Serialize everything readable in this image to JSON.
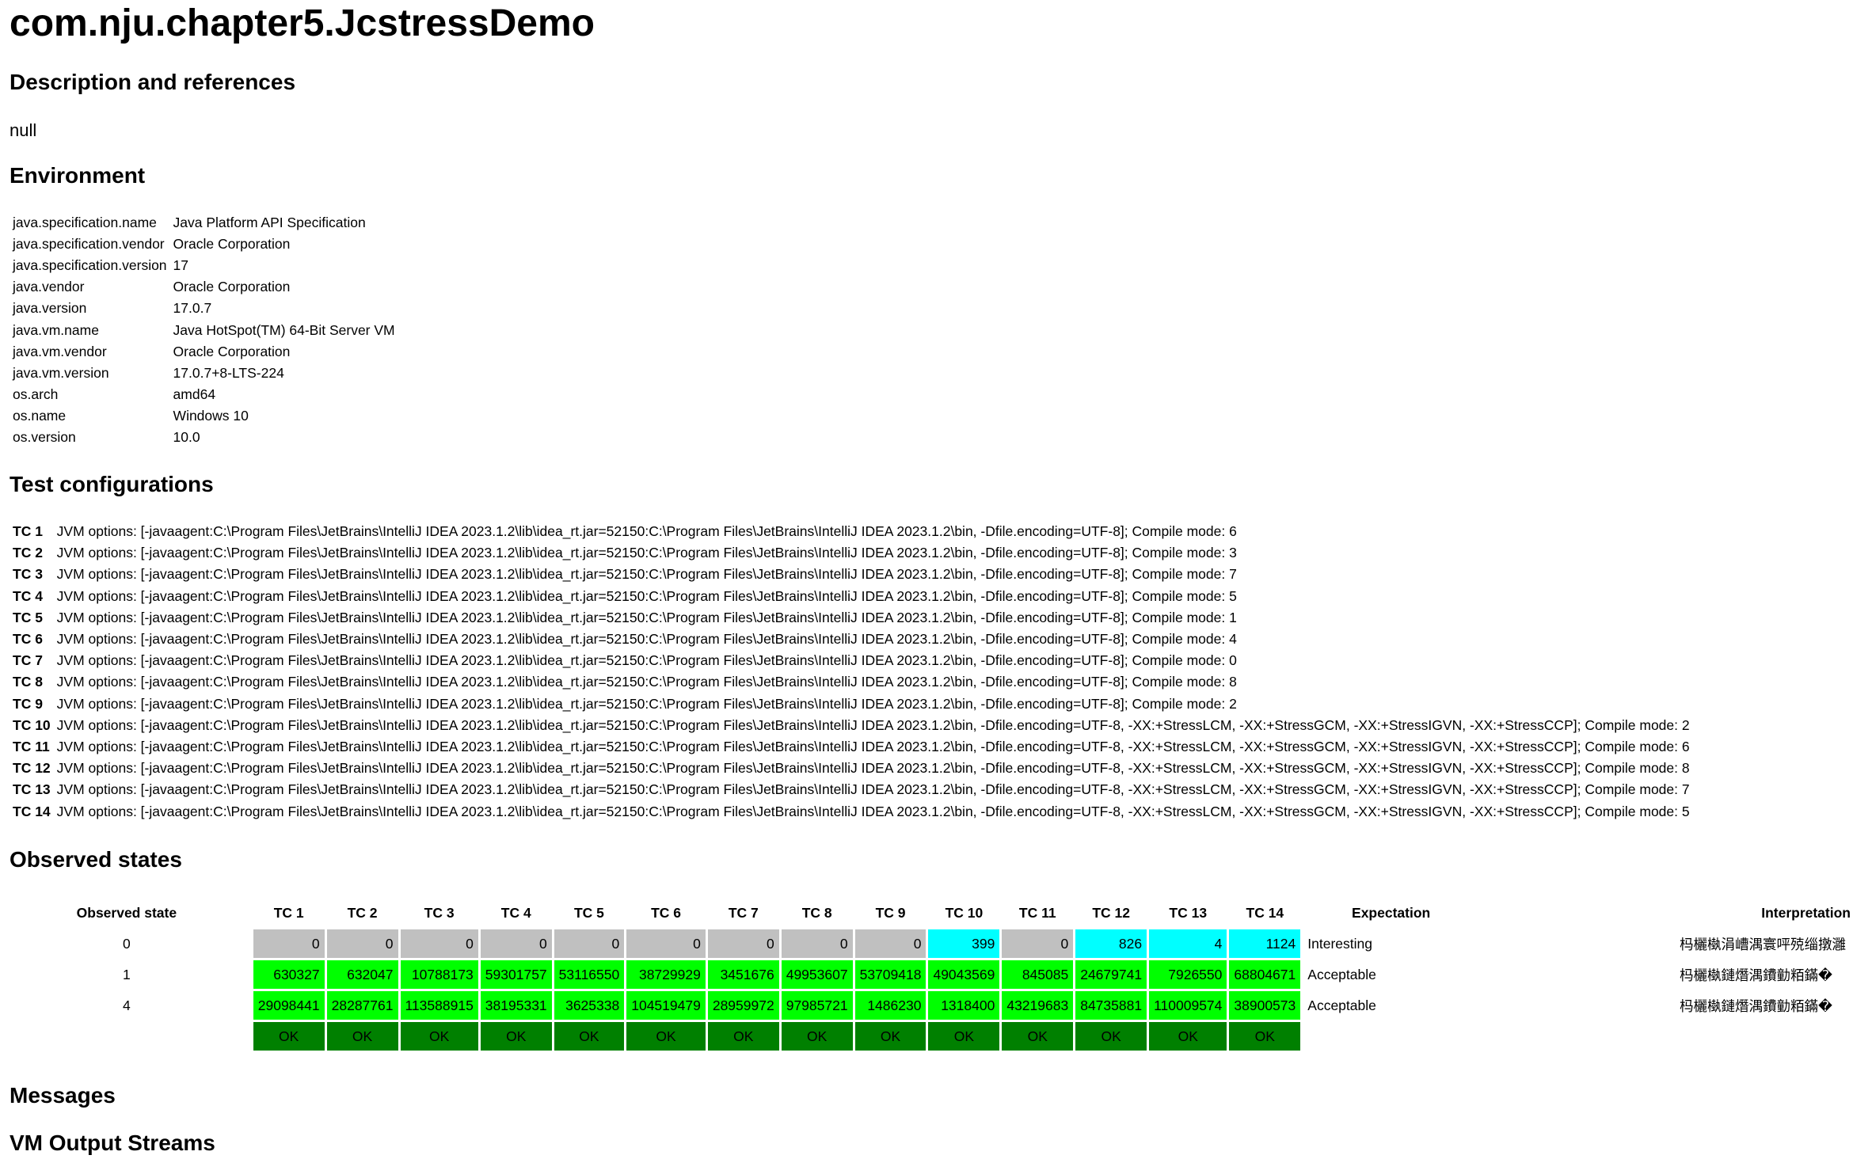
{
  "title": "com.nju.chapter5.JcstressDemo",
  "sections": {
    "description": "Description and references",
    "environment": "Environment",
    "test_configurations": "Test configurations",
    "observed_states": "Observed states",
    "messages": "Messages",
    "vm_output": "VM Output Streams"
  },
  "description_text": "null",
  "environment": [
    {
      "key": "java.specification.name",
      "value": "Java Platform API Specification"
    },
    {
      "key": "java.specification.vendor",
      "value": "Oracle Corporation"
    },
    {
      "key": "java.specification.version",
      "value": "17"
    },
    {
      "key": "java.vendor",
      "value": "Oracle Corporation"
    },
    {
      "key": "java.version",
      "value": "17.0.7"
    },
    {
      "key": "java.vm.name",
      "value": "Java HotSpot(TM) 64-Bit Server VM"
    },
    {
      "key": "java.vm.vendor",
      "value": "Oracle Corporation"
    },
    {
      "key": "java.vm.version",
      "value": "17.0.7+8-LTS-224"
    },
    {
      "key": "os.arch",
      "value": "amd64"
    },
    {
      "key": "os.name",
      "value": "Windows 10"
    },
    {
      "key": "os.version",
      "value": "10.0"
    }
  ],
  "test_configs": [
    {
      "name": "TC 1",
      "options": "JVM options: [-javaagent:C:\\Program Files\\JetBrains\\IntelliJ IDEA 2023.1.2\\lib\\idea_rt.jar=52150:C:\\Program Files\\JetBrains\\IntelliJ IDEA 2023.1.2\\bin, -Dfile.encoding=UTF-8]; Compile mode: 6"
    },
    {
      "name": "TC 2",
      "options": "JVM options: [-javaagent:C:\\Program Files\\JetBrains\\IntelliJ IDEA 2023.1.2\\lib\\idea_rt.jar=52150:C:\\Program Files\\JetBrains\\IntelliJ IDEA 2023.1.2\\bin, -Dfile.encoding=UTF-8]; Compile mode: 3"
    },
    {
      "name": "TC 3",
      "options": "JVM options: [-javaagent:C:\\Program Files\\JetBrains\\IntelliJ IDEA 2023.1.2\\lib\\idea_rt.jar=52150:C:\\Program Files\\JetBrains\\IntelliJ IDEA 2023.1.2\\bin, -Dfile.encoding=UTF-8]; Compile mode: 7"
    },
    {
      "name": "TC 4",
      "options": "JVM options: [-javaagent:C:\\Program Files\\JetBrains\\IntelliJ IDEA 2023.1.2\\lib\\idea_rt.jar=52150:C:\\Program Files\\JetBrains\\IntelliJ IDEA 2023.1.2\\bin, -Dfile.encoding=UTF-8]; Compile mode: 5"
    },
    {
      "name": "TC 5",
      "options": "JVM options: [-javaagent:C:\\Program Files\\JetBrains\\IntelliJ IDEA 2023.1.2\\lib\\idea_rt.jar=52150:C:\\Program Files\\JetBrains\\IntelliJ IDEA 2023.1.2\\bin, -Dfile.encoding=UTF-8]; Compile mode: 1"
    },
    {
      "name": "TC 6",
      "options": "JVM options: [-javaagent:C:\\Program Files\\JetBrains\\IntelliJ IDEA 2023.1.2\\lib\\idea_rt.jar=52150:C:\\Program Files\\JetBrains\\IntelliJ IDEA 2023.1.2\\bin, -Dfile.encoding=UTF-8]; Compile mode: 4"
    },
    {
      "name": "TC 7",
      "options": "JVM options: [-javaagent:C:\\Program Files\\JetBrains\\IntelliJ IDEA 2023.1.2\\lib\\idea_rt.jar=52150:C:\\Program Files\\JetBrains\\IntelliJ IDEA 2023.1.2\\bin, -Dfile.encoding=UTF-8]; Compile mode: 0"
    },
    {
      "name": "TC 8",
      "options": "JVM options: [-javaagent:C:\\Program Files\\JetBrains\\IntelliJ IDEA 2023.1.2\\lib\\idea_rt.jar=52150:C:\\Program Files\\JetBrains\\IntelliJ IDEA 2023.1.2\\bin, -Dfile.encoding=UTF-8]; Compile mode: 8"
    },
    {
      "name": "TC 9",
      "options": "JVM options: [-javaagent:C:\\Program Files\\JetBrains\\IntelliJ IDEA 2023.1.2\\lib\\idea_rt.jar=52150:C:\\Program Files\\JetBrains\\IntelliJ IDEA 2023.1.2\\bin, -Dfile.encoding=UTF-8]; Compile mode: 2"
    },
    {
      "name": "TC 10",
      "options": "JVM options: [-javaagent:C:\\Program Files\\JetBrains\\IntelliJ IDEA 2023.1.2\\lib\\idea_rt.jar=52150:C:\\Program Files\\JetBrains\\IntelliJ IDEA 2023.1.2\\bin, -Dfile.encoding=UTF-8, -XX:+StressLCM, -XX:+StressGCM, -XX:+StressIGVN, -XX:+StressCCP]; Compile mode: 2"
    },
    {
      "name": "TC 11",
      "options": "JVM options: [-javaagent:C:\\Program Files\\JetBrains\\IntelliJ IDEA 2023.1.2\\lib\\idea_rt.jar=52150:C:\\Program Files\\JetBrains\\IntelliJ IDEA 2023.1.2\\bin, -Dfile.encoding=UTF-8, -XX:+StressLCM, -XX:+StressGCM, -XX:+StressIGVN, -XX:+StressCCP]; Compile mode: 6"
    },
    {
      "name": "TC 12",
      "options": "JVM options: [-javaagent:C:\\Program Files\\JetBrains\\IntelliJ IDEA 2023.1.2\\lib\\idea_rt.jar=52150:C:\\Program Files\\JetBrains\\IntelliJ IDEA 2023.1.2\\bin, -Dfile.encoding=UTF-8, -XX:+StressLCM, -XX:+StressGCM, -XX:+StressIGVN, -XX:+StressCCP]; Compile mode: 8"
    },
    {
      "name": "TC 13",
      "options": "JVM options: [-javaagent:C:\\Program Files\\JetBrains\\IntelliJ IDEA 2023.1.2\\lib\\idea_rt.jar=52150:C:\\Program Files\\JetBrains\\IntelliJ IDEA 2023.1.2\\bin, -Dfile.encoding=UTF-8, -XX:+StressLCM, -XX:+StressGCM, -XX:+StressIGVN, -XX:+StressCCP]; Compile mode: 7"
    },
    {
      "name": "TC 14",
      "options": "JVM options: [-javaagent:C:\\Program Files\\JetBrains\\IntelliJ IDEA 2023.1.2\\lib\\idea_rt.jar=52150:C:\\Program Files\\JetBrains\\IntelliJ IDEA 2023.1.2\\bin, -Dfile.encoding=UTF-8, -XX:+StressLCM, -XX:+StressGCM, -XX:+StressIGVN, -XX:+StressCCP]; Compile mode: 5"
    }
  ],
  "observed": {
    "headers": {
      "state": "Observed state",
      "tcs": [
        "TC 1",
        "TC 2",
        "TC 3",
        "TC 4",
        "TC 5",
        "TC 6",
        "TC 7",
        "TC 8",
        "TC 9",
        "TC 10",
        "TC 11",
        "TC 12",
        "TC 13",
        "TC 14"
      ],
      "expectation": "Expectation",
      "interpretation": "Interpretation"
    },
    "colors": {
      "grey": "#c0c0c0",
      "green": "#00ff00",
      "cyan": "#00ffff",
      "ok": "#008000"
    },
    "rows": [
      {
        "state": "0",
        "values": [
          "0",
          "0",
          "0",
          "0",
          "0",
          "0",
          "0",
          "0",
          "0",
          "399",
          "0",
          "826",
          "4",
          "1124"
        ],
        "colors": [
          "grey",
          "grey",
          "grey",
          "grey",
          "grey",
          "grey",
          "grey",
          "grey",
          "grey",
          "cyan",
          "grey",
          "cyan",
          "cyan",
          "cyan"
        ],
        "expectation": "Interesting",
        "interpretation": "杩欐槸涓嶆湡寰呯殑缁撴灉"
      },
      {
        "state": "1",
        "values": [
          "630327",
          "632047",
          "10788173",
          "59301757",
          "53116550",
          "38729929",
          "3451676",
          "49953607",
          "53709418",
          "49043569",
          "845085",
          "24679741",
          "7926550",
          "68804671"
        ],
        "colors": [
          "green",
          "green",
          "green",
          "green",
          "green",
          "green",
          "green",
          "green",
          "green",
          "green",
          "green",
          "green",
          "green",
          "green"
        ],
        "expectation": "Acceptable",
        "interpretation": "杩欐槸鏈熸湡鐨勭粨鏋�"
      },
      {
        "state": "4",
        "values": [
          "29098441",
          "28287761",
          "113588915",
          "38195331",
          "3625338",
          "104519479",
          "28959972",
          "97985721",
          "1486230",
          "1318400",
          "43219683",
          "84735881",
          "110009574",
          "38900573"
        ],
        "colors": [
          "green",
          "green",
          "green",
          "green",
          "green",
          "green",
          "green",
          "green",
          "green",
          "green",
          "green",
          "green",
          "green",
          "green"
        ],
        "expectation": "Acceptable",
        "interpretation": "杩欐槸鏈熸湡鐨勭粨鏋�"
      }
    ],
    "status": [
      "OK",
      "OK",
      "OK",
      "OK",
      "OK",
      "OK",
      "OK",
      "OK",
      "OK",
      "OK",
      "OK",
      "OK",
      "OK",
      "OK"
    ]
  }
}
